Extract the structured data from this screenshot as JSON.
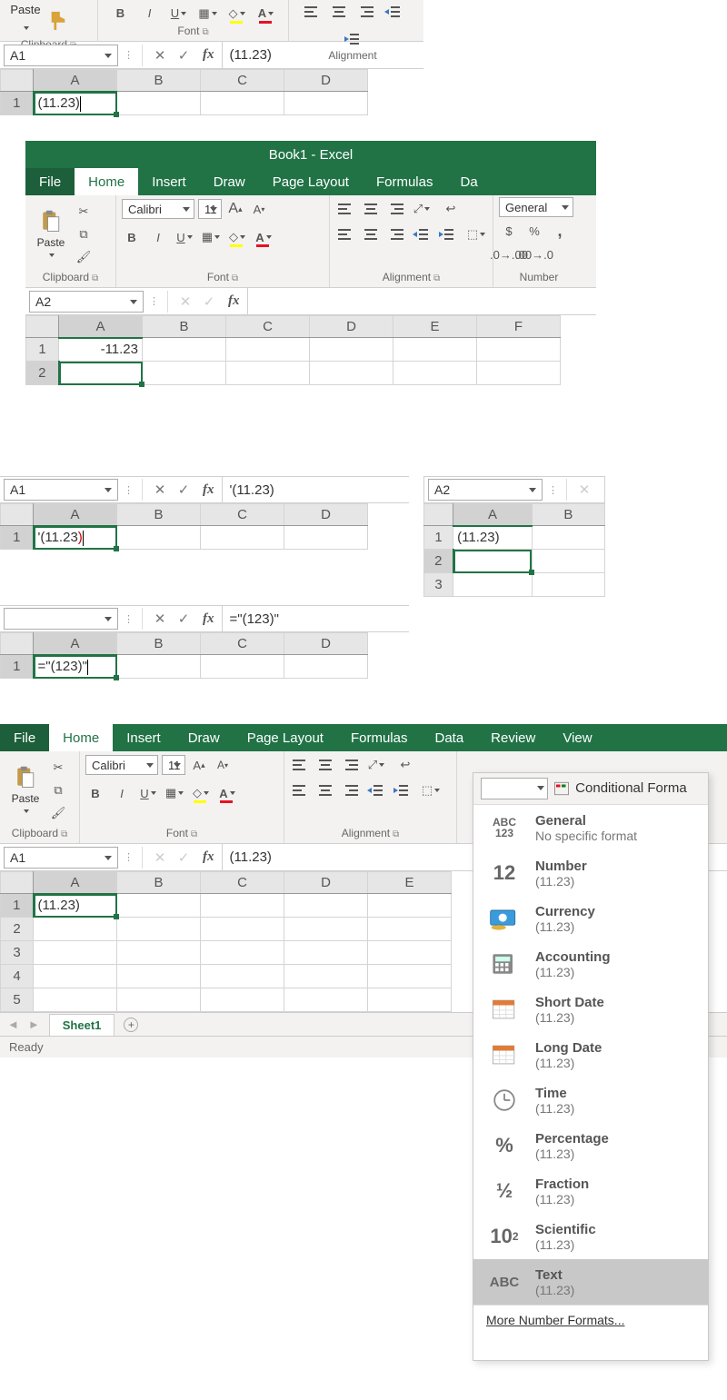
{
  "app": {
    "title": "Book1  -  Excel"
  },
  "tabs": {
    "file": "File",
    "home": "Home",
    "insert": "Insert",
    "draw": "Draw",
    "pagelayout": "Page Layout",
    "formulas": "Formulas",
    "data": "Data",
    "review": "Review",
    "view": "View"
  },
  "ribbon": {
    "paste": "Paste",
    "clipboard": "Clipboard",
    "font_group": "Font",
    "alignment": "Alignment",
    "number_group": "Number",
    "font_name": "Calibri",
    "font_size": "11",
    "number_format": "General",
    "conditional": "Conditional Forma"
  },
  "panel1": {
    "cellref": "A1",
    "fx": "(11.23)",
    "cols": [
      "A",
      "B",
      "C",
      "D"
    ],
    "rows": [
      "1"
    ],
    "A1": "(11.23)"
  },
  "panel2": {
    "cellref": "A2",
    "fx": "",
    "cols": [
      "A",
      "B",
      "C",
      "D",
      "E",
      "F"
    ],
    "rows": [
      "1",
      "2"
    ],
    "A1": "-11.23"
  },
  "panel3": {
    "cellref": "A1",
    "fx": "'(11.23)",
    "cols": [
      "A",
      "B",
      "C",
      "D"
    ],
    "rows": [
      "1"
    ],
    "A1_pre": "'(11.23",
    "A1_suf": ")"
  },
  "panel4": {
    "cellref": "A2",
    "cols": [
      "A",
      "B"
    ],
    "rows": [
      "1",
      "2",
      "3"
    ],
    "A1": "(11.23)"
  },
  "panel5": {
    "cellref": "",
    "fx": "=\"(123)\"",
    "cols": [
      "A",
      "B",
      "C",
      "D"
    ],
    "rows": [
      "1"
    ],
    "A1": "=\"(123)\""
  },
  "panel6": {
    "cellref": "A1",
    "fx": "(11.23)",
    "cols": [
      "A",
      "B",
      "C",
      "D",
      "E"
    ],
    "rows": [
      "1",
      "2",
      "3",
      "4",
      "5"
    ],
    "A1": "(11.23)",
    "sheet": "Sheet1",
    "ready": "Ready"
  },
  "nformat": {
    "general": {
      "name": "General",
      "sub": "No specific format"
    },
    "number": {
      "name": "Number",
      "sub": "(11.23)"
    },
    "currency": {
      "name": "Currency",
      "sub": "(11.23)"
    },
    "accounting": {
      "name": "Accounting",
      "sub": " (11.23)"
    },
    "shortdate": {
      "name": "Short Date",
      "sub": "(11.23)"
    },
    "longdate": {
      "name": "Long Date",
      "sub": "(11.23)"
    },
    "time": {
      "name": "Time",
      "sub": "(11.23)"
    },
    "percentage": {
      "name": "Percentage",
      "sub": "(11.23)"
    },
    "fraction": {
      "name": "Fraction",
      "sub": "(11.23)"
    },
    "scientific": {
      "name": "Scientific",
      "sub": "(11.23)"
    },
    "text": {
      "name": "Text",
      "sub": "(11.23)"
    },
    "more": "More Number Formats..."
  },
  "icons": {
    "general": "ABC\n123",
    "number": "12",
    "percentage": "%",
    "fraction": "½",
    "scientific": "10²",
    "text": "ABC"
  }
}
